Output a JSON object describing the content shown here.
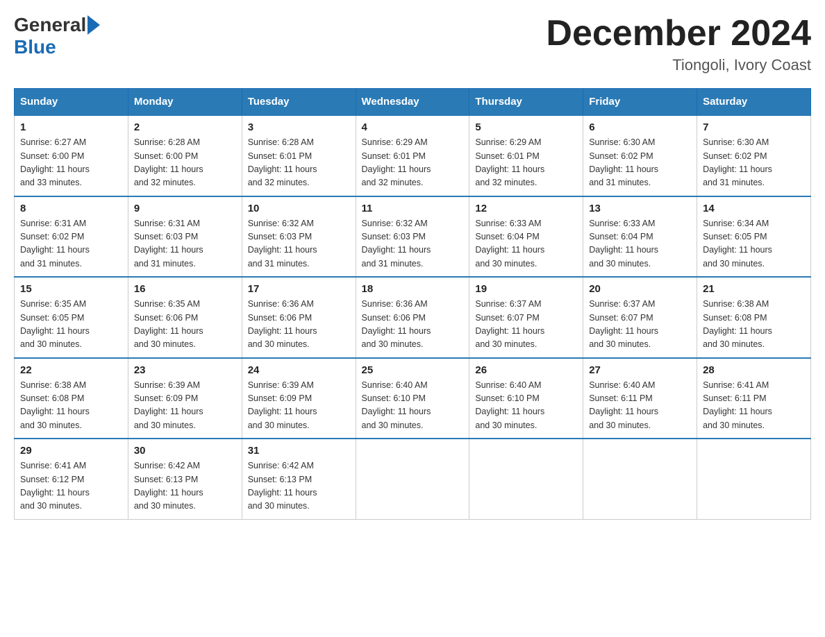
{
  "logo": {
    "general": "General",
    "blue": "Blue"
  },
  "header": {
    "month": "December 2024",
    "location": "Tiongoli, Ivory Coast"
  },
  "days_of_week": [
    "Sunday",
    "Monday",
    "Tuesday",
    "Wednesday",
    "Thursday",
    "Friday",
    "Saturday"
  ],
  "weeks": [
    [
      {
        "day": "1",
        "sunrise": "6:27 AM",
        "sunset": "6:00 PM",
        "daylight": "11 hours and 33 minutes."
      },
      {
        "day": "2",
        "sunrise": "6:28 AM",
        "sunset": "6:00 PM",
        "daylight": "11 hours and 32 minutes."
      },
      {
        "day": "3",
        "sunrise": "6:28 AM",
        "sunset": "6:01 PM",
        "daylight": "11 hours and 32 minutes."
      },
      {
        "day": "4",
        "sunrise": "6:29 AM",
        "sunset": "6:01 PM",
        "daylight": "11 hours and 32 minutes."
      },
      {
        "day": "5",
        "sunrise": "6:29 AM",
        "sunset": "6:01 PM",
        "daylight": "11 hours and 32 minutes."
      },
      {
        "day": "6",
        "sunrise": "6:30 AM",
        "sunset": "6:02 PM",
        "daylight": "11 hours and 31 minutes."
      },
      {
        "day": "7",
        "sunrise": "6:30 AM",
        "sunset": "6:02 PM",
        "daylight": "11 hours and 31 minutes."
      }
    ],
    [
      {
        "day": "8",
        "sunrise": "6:31 AM",
        "sunset": "6:02 PM",
        "daylight": "11 hours and 31 minutes."
      },
      {
        "day": "9",
        "sunrise": "6:31 AM",
        "sunset": "6:03 PM",
        "daylight": "11 hours and 31 minutes."
      },
      {
        "day": "10",
        "sunrise": "6:32 AM",
        "sunset": "6:03 PM",
        "daylight": "11 hours and 31 minutes."
      },
      {
        "day": "11",
        "sunrise": "6:32 AM",
        "sunset": "6:03 PM",
        "daylight": "11 hours and 31 minutes."
      },
      {
        "day": "12",
        "sunrise": "6:33 AM",
        "sunset": "6:04 PM",
        "daylight": "11 hours and 30 minutes."
      },
      {
        "day": "13",
        "sunrise": "6:33 AM",
        "sunset": "6:04 PM",
        "daylight": "11 hours and 30 minutes."
      },
      {
        "day": "14",
        "sunrise": "6:34 AM",
        "sunset": "6:05 PM",
        "daylight": "11 hours and 30 minutes."
      }
    ],
    [
      {
        "day": "15",
        "sunrise": "6:35 AM",
        "sunset": "6:05 PM",
        "daylight": "11 hours and 30 minutes."
      },
      {
        "day": "16",
        "sunrise": "6:35 AM",
        "sunset": "6:06 PM",
        "daylight": "11 hours and 30 minutes."
      },
      {
        "day": "17",
        "sunrise": "6:36 AM",
        "sunset": "6:06 PM",
        "daylight": "11 hours and 30 minutes."
      },
      {
        "day": "18",
        "sunrise": "6:36 AM",
        "sunset": "6:06 PM",
        "daylight": "11 hours and 30 minutes."
      },
      {
        "day": "19",
        "sunrise": "6:37 AM",
        "sunset": "6:07 PM",
        "daylight": "11 hours and 30 minutes."
      },
      {
        "day": "20",
        "sunrise": "6:37 AM",
        "sunset": "6:07 PM",
        "daylight": "11 hours and 30 minutes."
      },
      {
        "day": "21",
        "sunrise": "6:38 AM",
        "sunset": "6:08 PM",
        "daylight": "11 hours and 30 minutes."
      }
    ],
    [
      {
        "day": "22",
        "sunrise": "6:38 AM",
        "sunset": "6:08 PM",
        "daylight": "11 hours and 30 minutes."
      },
      {
        "day": "23",
        "sunrise": "6:39 AM",
        "sunset": "6:09 PM",
        "daylight": "11 hours and 30 minutes."
      },
      {
        "day": "24",
        "sunrise": "6:39 AM",
        "sunset": "6:09 PM",
        "daylight": "11 hours and 30 minutes."
      },
      {
        "day": "25",
        "sunrise": "6:40 AM",
        "sunset": "6:10 PM",
        "daylight": "11 hours and 30 minutes."
      },
      {
        "day": "26",
        "sunrise": "6:40 AM",
        "sunset": "6:10 PM",
        "daylight": "11 hours and 30 minutes."
      },
      {
        "day": "27",
        "sunrise": "6:40 AM",
        "sunset": "6:11 PM",
        "daylight": "11 hours and 30 minutes."
      },
      {
        "day": "28",
        "sunrise": "6:41 AM",
        "sunset": "6:11 PM",
        "daylight": "11 hours and 30 minutes."
      }
    ],
    [
      {
        "day": "29",
        "sunrise": "6:41 AM",
        "sunset": "6:12 PM",
        "daylight": "11 hours and 30 minutes."
      },
      {
        "day": "30",
        "sunrise": "6:42 AM",
        "sunset": "6:13 PM",
        "daylight": "11 hours and 30 minutes."
      },
      {
        "day": "31",
        "sunrise": "6:42 AM",
        "sunset": "6:13 PM",
        "daylight": "11 hours and 30 minutes."
      },
      null,
      null,
      null,
      null
    ]
  ],
  "labels": {
    "sunrise": "Sunrise:",
    "sunset": "Sunset:",
    "daylight": "Daylight:"
  }
}
